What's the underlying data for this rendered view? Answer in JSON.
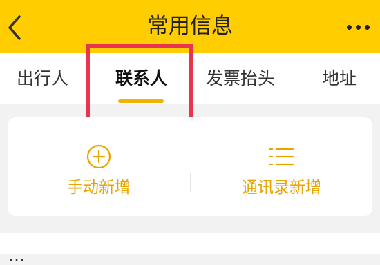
{
  "header": {
    "title": "常用信息",
    "background_color": "#ffcd00",
    "back_icon": "chevron-left-icon",
    "more_icon": "more-horizontal-icon"
  },
  "tabs": [
    {
      "label": "出行人",
      "active": false
    },
    {
      "label": "联系人",
      "active": true
    },
    {
      "label": "发票抬头",
      "active": false
    },
    {
      "label": "地址",
      "active": false
    }
  ],
  "accent_color": "#f3b200",
  "highlight_color": "#e8344e",
  "add_card": {
    "manual": {
      "label": "手动新增",
      "icon": "plus-circle-icon"
    },
    "contacts": {
      "label": "通讯录新增",
      "icon": "list-icon"
    }
  },
  "list": {
    "partial_item_text": "…"
  }
}
